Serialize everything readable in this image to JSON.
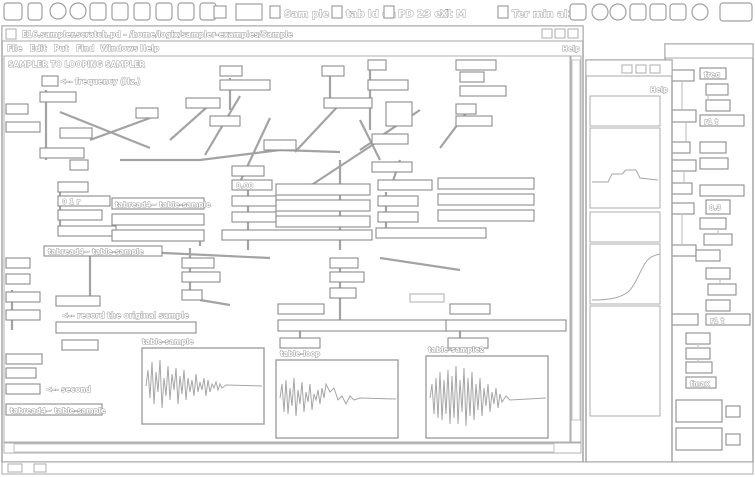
{
  "taskbar": {
    "items": [
      "Sam ple r",
      "tab ld oa r",
      "PD 23 ed",
      "Xt M",
      "Ter min al>"
    ]
  },
  "front_window": {
    "title": "E16.sampler.scratch.pd - /home/logix/sampler-examples/Sample",
    "menu": [
      "File",
      "Edit",
      "Put",
      "Find",
      "Windows",
      "Help"
    ],
    "help_corner": "Help",
    "comment_heading": "SAMPLER TO LOOPING SAMPLER",
    "comment_freq": "<-- frequency (Hz.)",
    "comment_record": "<-- record the original sample",
    "comment_second": "<-- second",
    "array_labels": [
      "table-sample",
      "table-loop",
      "table-sample2"
    ],
    "bottom_obj": "tabread4~ table-sample",
    "obj_text": "tabread4~ table-sample",
    "msg_text": "0 1 r",
    "num_text": "0.00"
  },
  "middle_window": {
    "help_corner": "Help"
  },
  "back_window": {
    "labels": [
      "freq",
      "r1 t",
      "0.3",
      "r1 t",
      "fmax"
    ]
  }
}
